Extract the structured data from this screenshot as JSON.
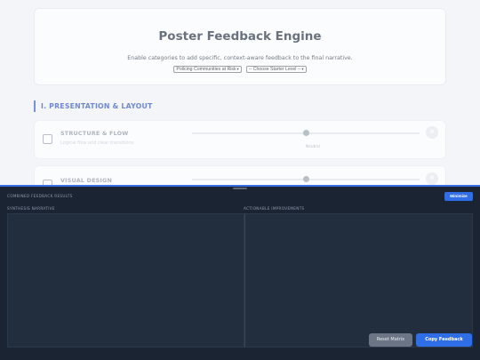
{
  "header": {
    "title": "Poster Feedback Engine",
    "subtitle": "Enable categories to add specific, context-aware feedback to the final narrative.",
    "topic_select": "Policing Communities at Risk",
    "level_select": "-- Choose Starter Level --"
  },
  "section": {
    "title": "I. PRESENTATION & LAYOUT"
  },
  "categories": [
    {
      "title": "STRUCTURE & FLOW",
      "description": "Logical flow and clear transitions",
      "slider_label": "Neutral",
      "slider_value_fraction": 0.5,
      "score": "0"
    },
    {
      "title": "VISUAL DESIGN",
      "score": "0"
    }
  ],
  "results": {
    "title": "COMBINED FEEDBACK RESULTS",
    "minimize_label": "Minimize",
    "narrative_label": "SYNTHESIS NARRATIVE",
    "improvements_label": "ACTIONABLE IMPROVEMENTS",
    "narrative_text": "",
    "improvements_text": "",
    "reset_label": "Reset Matrix",
    "copy_label": "Copy Feedback"
  },
  "colors": {
    "accent": "#2f6ee6",
    "panel_bg": "#1b2433",
    "section_title": "#2b4db8"
  }
}
